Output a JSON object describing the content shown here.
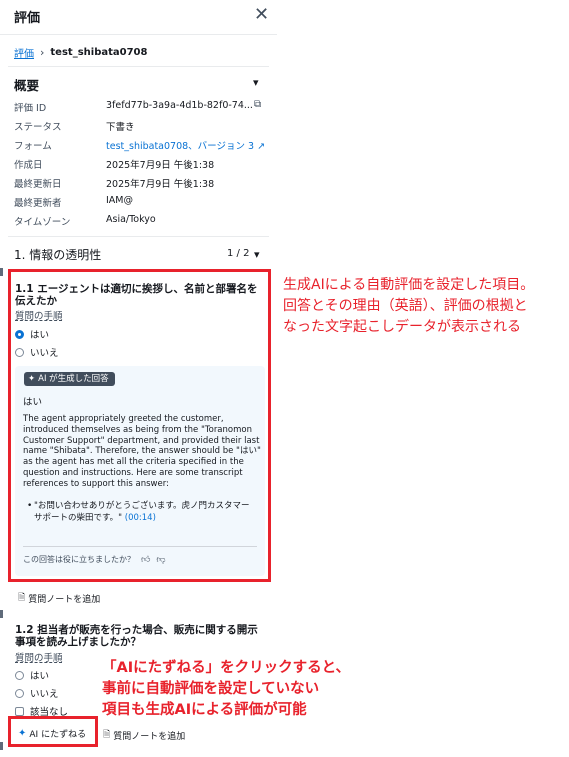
{
  "panel": {
    "title": "評価",
    "close_icon": "close-icon"
  },
  "breadcrumb": {
    "root": "評価",
    "current": "test_shibata0708"
  },
  "overview": {
    "title": "概要",
    "rows": [
      {
        "label": "評価 ID",
        "value": "3fefd77b-3a9a-4d1b-82f0-74..."
      },
      {
        "label": "ステータス",
        "value": "下書き"
      },
      {
        "label": "フォーム",
        "value": "test_shibata0708、バージョン 3"
      },
      {
        "label": "作成日",
        "value": "2025年7月9日 午後1:38"
      },
      {
        "label": "最終更新日",
        "value": "2025年7月9日 午後1:38"
      },
      {
        "label": "最終更新者",
        "value": "IAM@"
      },
      {
        "label": "タイムゾーン",
        "value": "Asia/Tokyo"
      }
    ]
  },
  "section": {
    "title": "1. 情報の透明性",
    "page": "1 / 2"
  },
  "q1": {
    "title": "1.1 エージェントは適切に挨拶し、名前と部署名を伝えたか",
    "instructions": "質問の手順",
    "options": [
      "はい",
      "いいえ"
    ],
    "selected": "はい",
    "ai": {
      "badge": "AI が生成した回答",
      "answer": "はい",
      "reason": "The agent appropriately greeted the customer, introduced themselves as being from the \"Toranomon Customer Support\" department, and provided their last name \"Shibata\". Therefore, the answer should be \"はい\" as the agent has met all the criteria specified in the question and instructions. Here are some transcript references to support this answer:",
      "reference_quote": "\"お問い合わせありがとうございます。虎ノ門カスタマーサポートの柴田です。\"",
      "reference_ts": "(00:14)",
      "feedback_prompt": "この回答は役に立ちましたか？"
    },
    "add_note": "質問ノートを追加"
  },
  "q2": {
    "title": "1.2 担当者が販売を行った場合、販売に関する開示事項を読み上げましたか？",
    "instructions": "質問の手順",
    "options": [
      "はい",
      "いいえ"
    ],
    "na_option": "該当なし",
    "ask_ai": "AI にたずねる",
    "add_note": "質問ノートを追加"
  },
  "annotations": {
    "a1": [
      "生成AIによる自動評価を設定した項目。",
      "回答とその理由（英語）、評価の根拠と",
      "なった文字起こしデータが表示される"
    ],
    "a2": [
      "「AIにたずねる」をクリックすると、",
      "事前に自動評価を設定していない",
      "項目も生成AIによる評価が可能"
    ]
  },
  "colors": {
    "accent": "#0972d3",
    "annotation_red": "#e8222c",
    "ai_box_bg": "#f2f8fd"
  }
}
